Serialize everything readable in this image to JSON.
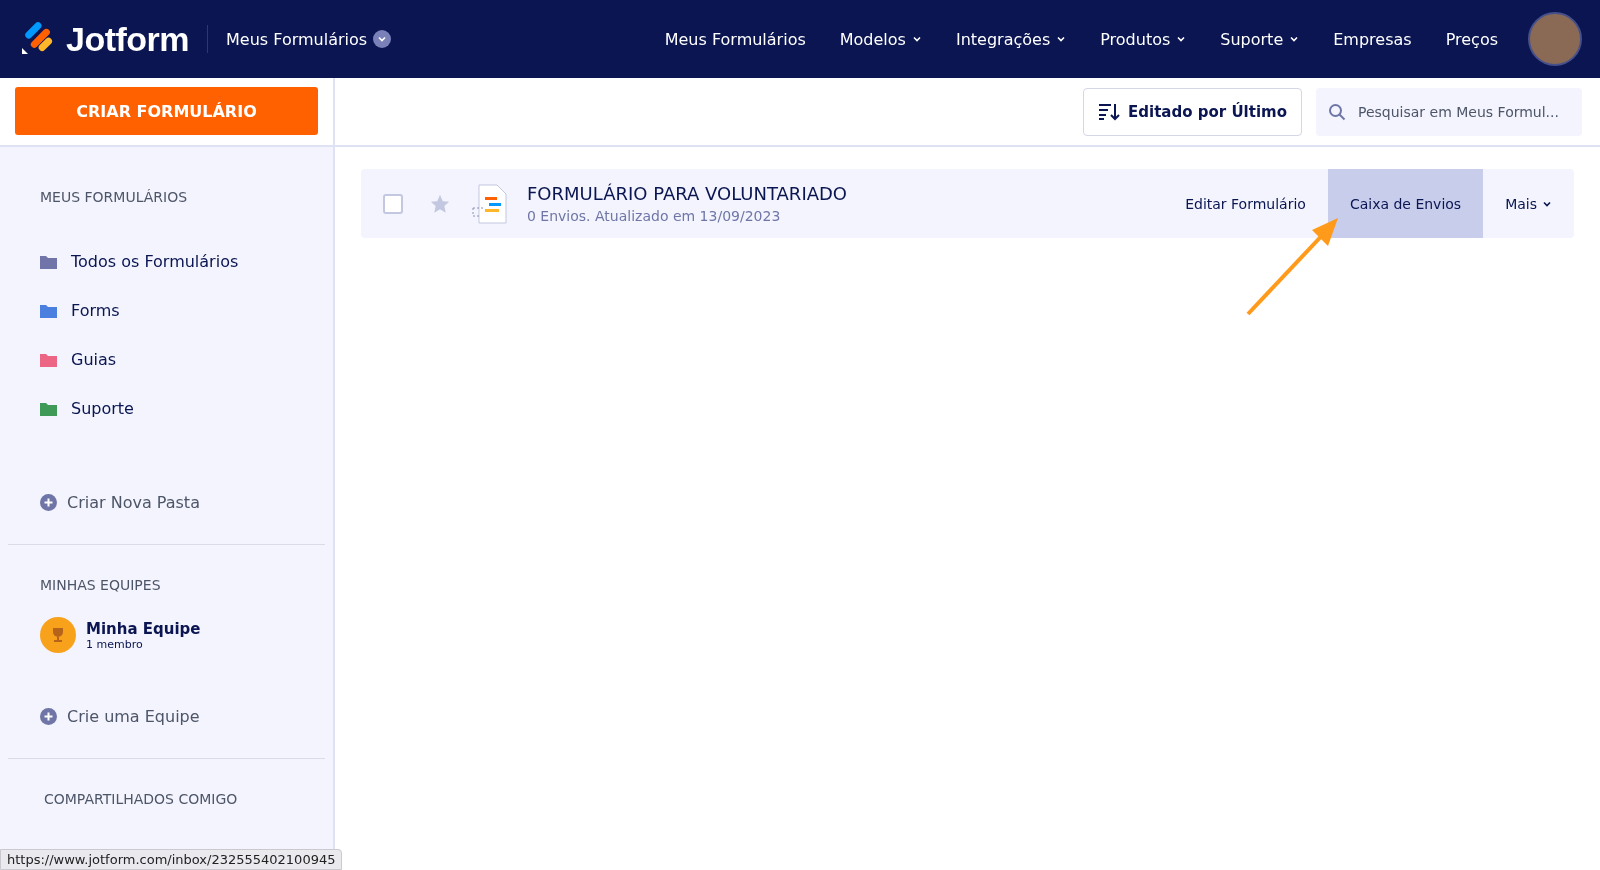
{
  "header": {
    "logo": "Jotform",
    "context_menu": "Meus Formulários",
    "nav": [
      {
        "label": "Meus Formulários",
        "has_menu": false
      },
      {
        "label": "Modelos",
        "has_menu": true
      },
      {
        "label": "Integrações",
        "has_menu": true
      },
      {
        "label": "Produtos",
        "has_menu": true
      },
      {
        "label": "Suporte",
        "has_menu": true
      },
      {
        "label": "Empresas",
        "has_menu": false
      },
      {
        "label": "Preços",
        "has_menu": false
      }
    ]
  },
  "create_button": "CRIAR FORMULÁRIO",
  "sort_button": "Editado por Último",
  "search": {
    "placeholder": "Pesquisar em Meus Formul..."
  },
  "sidebar": {
    "my_forms_heading": "MEUS FORMULÁRIOS",
    "folders": [
      {
        "label": "Todos os Formulários",
        "color": "#7074a8"
      },
      {
        "label": "Forms",
        "color": "#4a7fe0"
      },
      {
        "label": "Guias",
        "color": "#ec6585"
      },
      {
        "label": "Suporte",
        "color": "#3f9a57"
      }
    ],
    "new_folder": "Criar Nova Pasta",
    "teams_heading": "MINHAS EQUIPES",
    "team": {
      "name": "Minha Equipe",
      "members": "1 membro"
    },
    "new_team": "Crie uma Equipe",
    "shared_heading": "COMPARTILHADOS COMIGO"
  },
  "forms": [
    {
      "title": "FORMULÁRIO PARA VOLUNTARIADO",
      "meta": "0 Envios. Atualizado em 13/09/2023",
      "checked": false,
      "starred": false,
      "actions": [
        {
          "label": "Editar Formulário",
          "selected": false,
          "kind": "plain"
        },
        {
          "label": "Caixa de Envios",
          "selected": true,
          "kind": "plain"
        },
        {
          "label": "Mais",
          "selected": false,
          "kind": "menu"
        }
      ]
    }
  ],
  "status_url": "https://www.jotform.com/inbox/232555402100945"
}
